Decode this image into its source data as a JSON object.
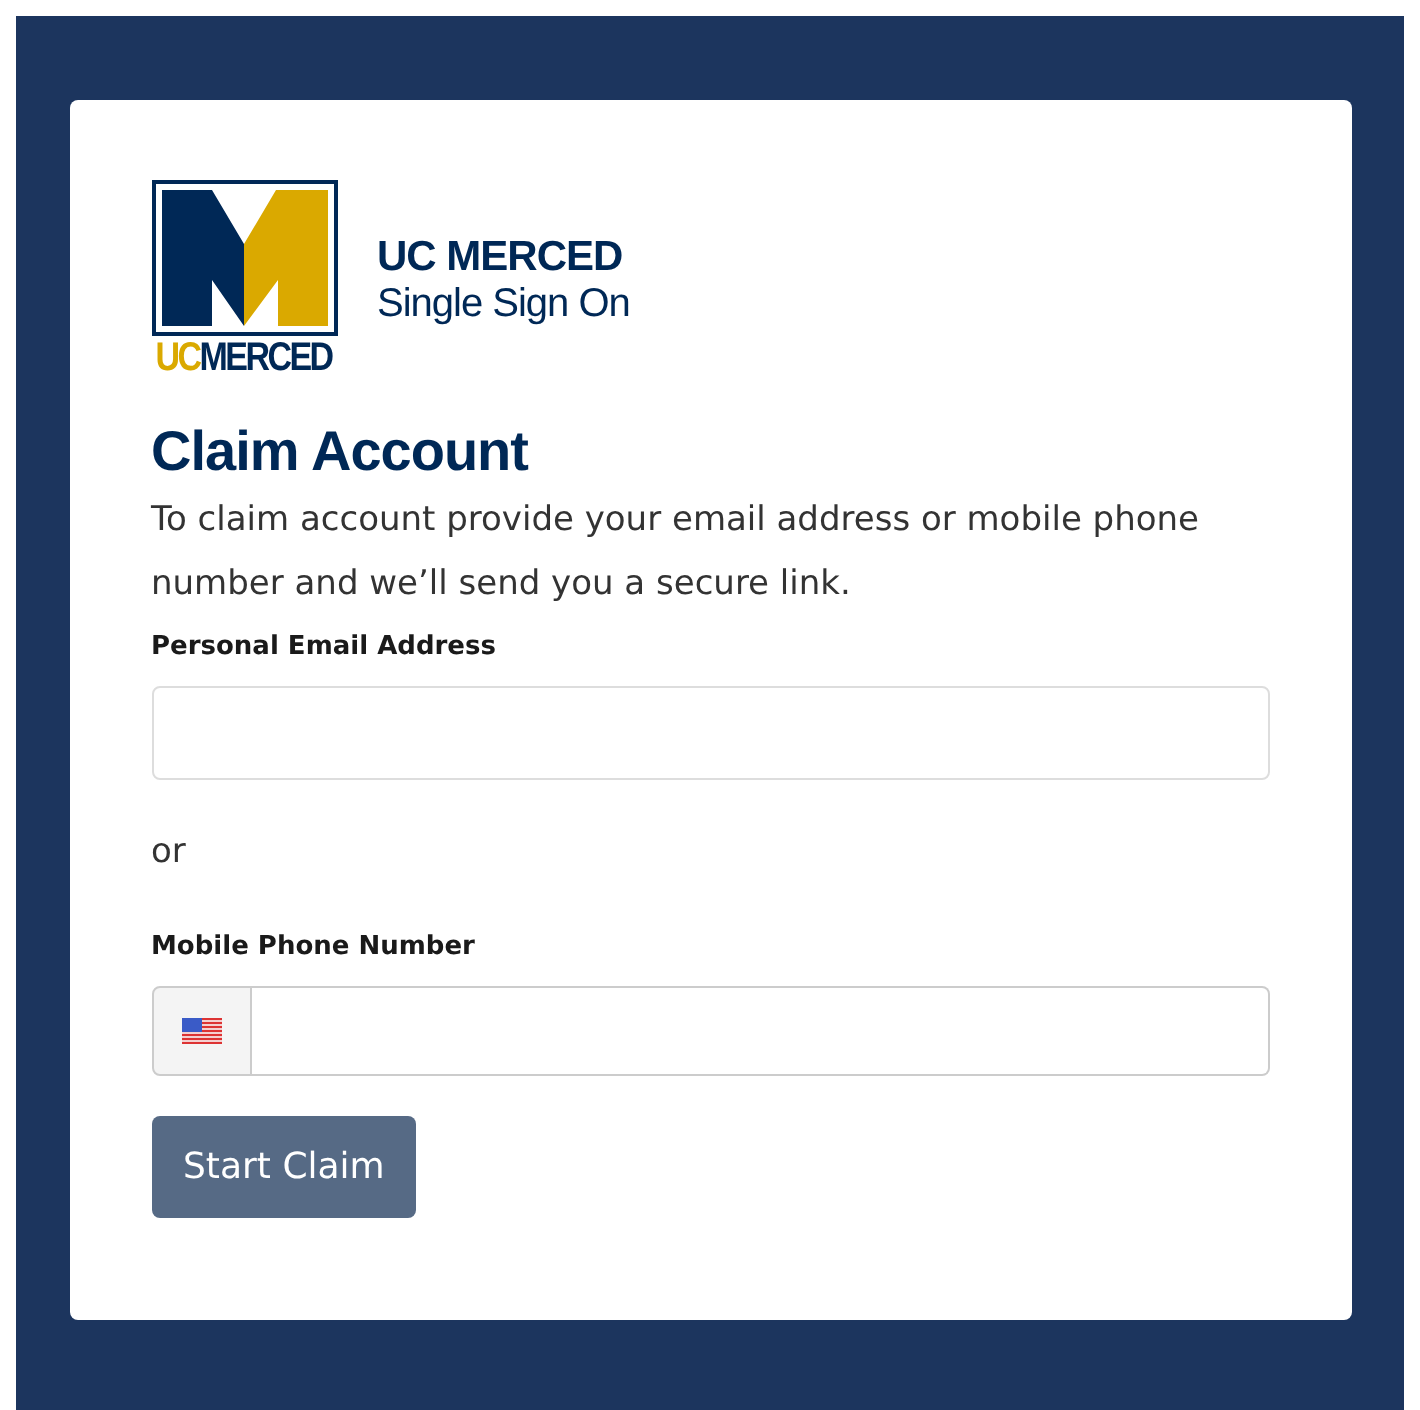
{
  "logo": {
    "mark_left": "UC",
    "mark_right": "MERCED"
  },
  "brand": {
    "name": "UC MERCED",
    "subtitle": "Single Sign On"
  },
  "heading": "Claim Account",
  "intro": "To claim account provide your email address or mobile phone number and we’ll send you a secure link.",
  "email_field": {
    "label": "Personal Email Address"
  },
  "separator": "or",
  "phone_field": {
    "label": "Mobile Phone Number"
  },
  "submit": {
    "label": "Start Claim",
    "disabled": true
  }
}
